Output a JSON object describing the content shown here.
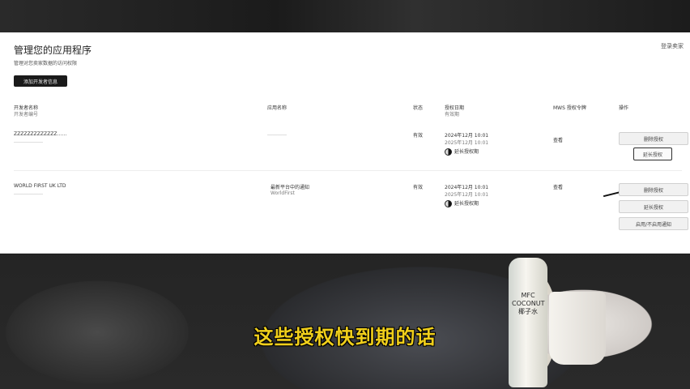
{
  "page": {
    "title": "管理您的应用程序",
    "subtitle": "管理对您卖家数据的访问权限",
    "top_right_link": "登录卖家",
    "add_button": "添加开发者信息"
  },
  "table": {
    "headers": {
      "developer": "开发者名称",
      "developer_sub": "开发者编号",
      "app": "应用名称",
      "status": "状态",
      "auth_date": "授权日期",
      "auth_date_sub": "有效期",
      "mws": "MWS 授权令牌",
      "actions": "操作"
    },
    "rows": [
      {
        "developer": "ZZZZZZZZZZZZZ……",
        "developer_sub": "………………",
        "app": "…………",
        "app_sub": "",
        "status": "有效",
        "date": "2024年12月 10:01",
        "expiry": "2025年12月 10:01",
        "extend_label": "延长授权期",
        "mws": "查看",
        "buttons": [
          "删除授权",
          "延长授权"
        ]
      },
      {
        "developer": "WORLD FIRST UK LTD",
        "developer_sub": "………………",
        "app": "最新平台中的通知",
        "app_sub": "WorldFirst",
        "status": "有效",
        "date": "2024年12月 10:01",
        "expiry": "2025年12月 10:01",
        "extend_label": "延长授权期",
        "mws": "查看",
        "buttons": [
          "删除授权",
          "延长授权",
          "启用/不启用通知"
        ]
      }
    ]
  },
  "video": {
    "caption": "这些授权快到期的话",
    "bottle_label": "MFC COCONUT 椰子水"
  }
}
